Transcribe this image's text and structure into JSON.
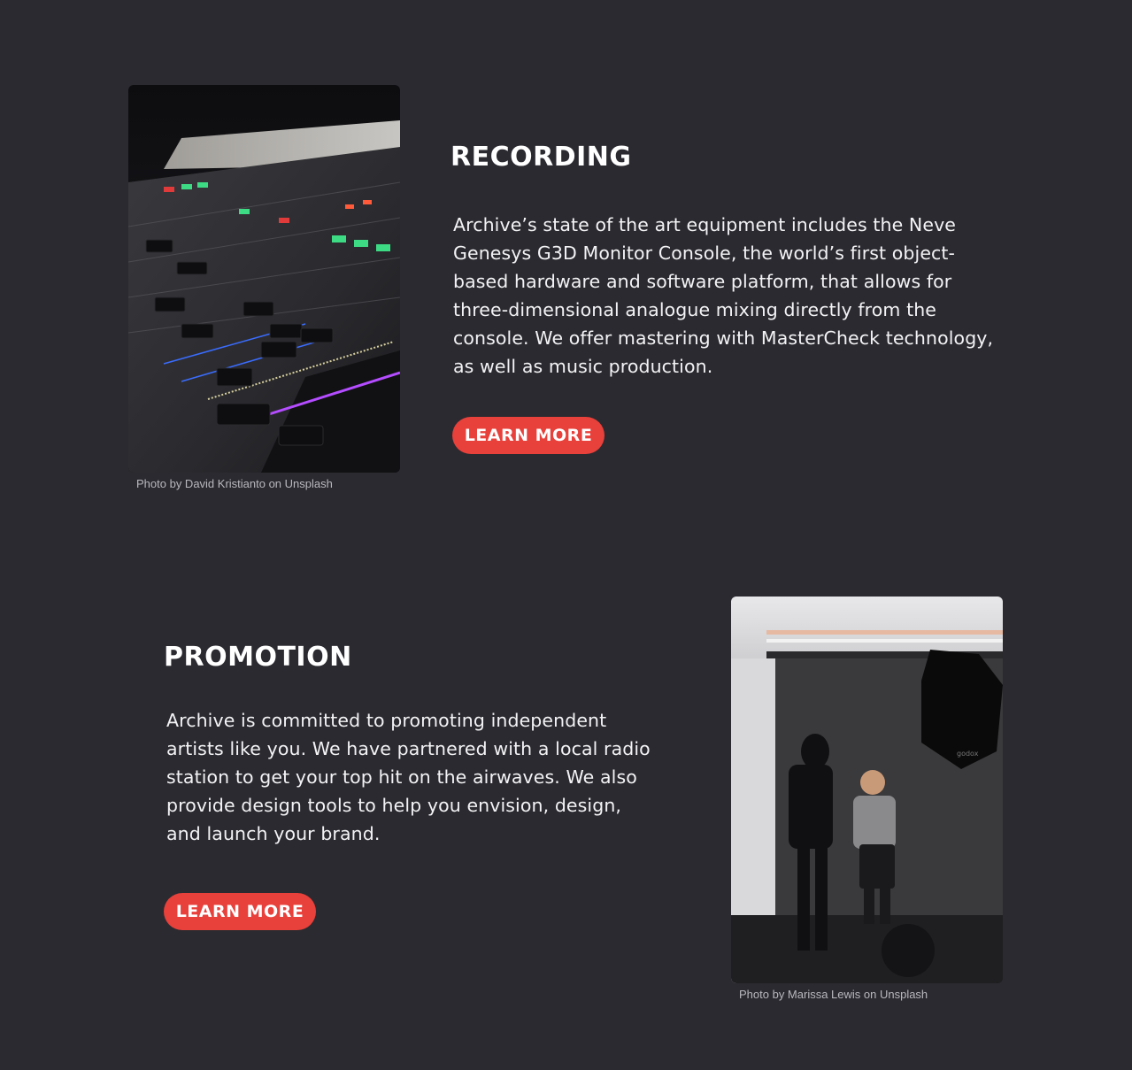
{
  "recording": {
    "heading": "RECORDING",
    "body": "Archive’s state of the art equipment includes the Neve Genesys G3D Monitor Console, the world’s first object-based hardware and software platform, that allows for three-dimensional analogue mixing directly from the console. We offer mastering with MasterCheck technology, as well as music production.",
    "button_label": "LEARN MORE",
    "photo_caption": "Photo by David Kristianto on Unsplash",
    "photo_alt": "mixing-console-photo"
  },
  "promotion": {
    "heading": "PROMOTION",
    "body": "Archive is committed to promoting independent artists like you. We have partnered with a local radio station to get your top hit on the airwaves. We also provide design tools to help you envision, design, and launch your brand.",
    "button_label": "LEARN MORE",
    "photo_caption": "Photo by Marissa Lewis on Unsplash",
    "photo_alt": "photo-studio-shoot-photo"
  },
  "colors": {
    "background": "#2b2a30",
    "accent": "#e8403a",
    "text": "#ffffff",
    "caption": "#b9b8bf"
  }
}
